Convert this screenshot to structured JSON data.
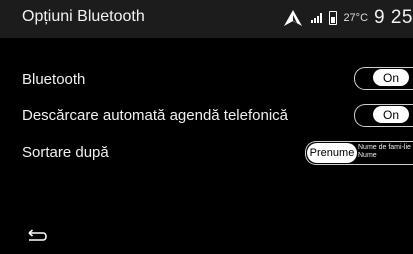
{
  "header": {
    "title": "Opțiuni Bluetooth",
    "temperature": "27°C",
    "clock": "9 25"
  },
  "settings": [
    {
      "label": "Bluetooth",
      "toggle": "On"
    },
    {
      "label": "Descărcare automată agendă telefonică",
      "toggle": "On"
    }
  ],
  "sort": {
    "label": "Sortare după",
    "selected": "Prenume",
    "other": "Nume de fami-lie Nume"
  },
  "icons": {
    "navigation": "navigation-arrow-icon",
    "signal": "signal-icon",
    "battery": "battery-icon",
    "back": "back-arrow-icon"
  }
}
